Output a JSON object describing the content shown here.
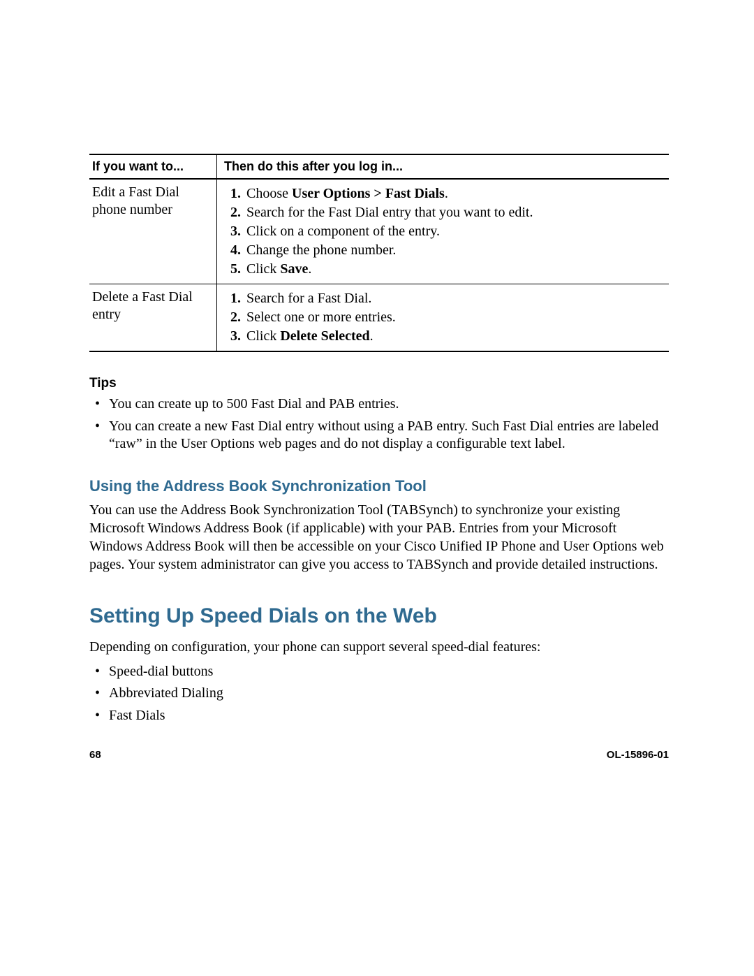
{
  "table": {
    "headers": [
      "If you want to...",
      "Then do this after you log in..."
    ],
    "rows": [
      {
        "task": "Edit a Fast Dial phone number",
        "steps": [
          {
            "pre": "Choose ",
            "bold": "User Options > Fast Dials",
            "post": "."
          },
          {
            "pre": "Search for the Fast Dial entry that you want to edit.",
            "bold": "",
            "post": ""
          },
          {
            "pre": "Click on a component of the entry.",
            "bold": "",
            "post": ""
          },
          {
            "pre": "Change the phone number.",
            "bold": "",
            "post": ""
          },
          {
            "pre": "Click ",
            "bold": "Save",
            "post": "."
          }
        ]
      },
      {
        "task": "Delete a Fast Dial entry",
        "steps": [
          {
            "pre": "Search for a Fast Dial.",
            "bold": "",
            "post": ""
          },
          {
            "pre": "Select one or more entries.",
            "bold": "",
            "post": ""
          },
          {
            "pre": "Click ",
            "bold": "Delete Selected",
            "post": "."
          }
        ]
      }
    ]
  },
  "tips": {
    "heading": "Tips",
    "items": [
      "You can create up to 500 Fast Dial and PAB entries.",
      "You can create a new Fast Dial entry without using a PAB entry. Such Fast Dial entries are labeled “raw” in the User Options web pages and do not display a configurable text label."
    ]
  },
  "section_sync": {
    "heading": "Using the Address Book Synchronization Tool",
    "body": "You can use the Address Book Synchronization Tool (TABSynch) to synchronize your existing Microsoft Windows Address Book (if applicable) with your PAB. Entries from your Microsoft Windows Address Book will then be accessible on your Cisco Unified IP Phone and User Options web pages. Your system administrator can give you access to TABSynch and provide detailed instructions."
  },
  "section_speed": {
    "heading": "Setting Up Speed Dials on the Web",
    "intro": "Depending on configuration, your phone can support several speed-dial features:",
    "bullets": [
      "Speed-dial buttons",
      "Abbreviated Dialing",
      "Fast Dials"
    ]
  },
  "footer": {
    "page": "68",
    "docid": "OL-15896-01"
  }
}
